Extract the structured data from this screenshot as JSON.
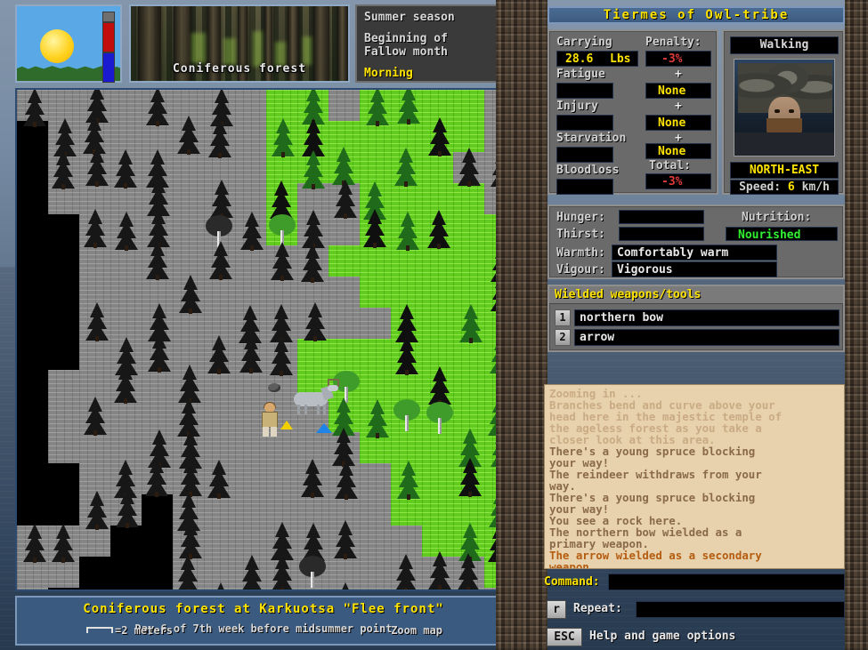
{
  "window": {
    "title": "Tiermes of Owl-tribe"
  },
  "sky_widget": {
    "name": "sky-and-temperature-gauge"
  },
  "biome": {
    "label": "Coniferous forest"
  },
  "season_box": {
    "line1": "Summer season",
    "line2a": "Beginning of",
    "line2b": "Fallow month",
    "line3": "Morning"
  },
  "stats": {
    "carrying_label": "Carrying",
    "carrying_value": "28.6",
    "carrying_unit": "Lbs",
    "penalty_label": "Penalty:",
    "penalty_value": "-3%",
    "fatigue_label": "Fatigue",
    "fatigue_value": "None",
    "injury_label": "Injury",
    "injury_value": "None",
    "starvation_label": "Starvation",
    "starvation_value": "None",
    "total_label": "Total:",
    "total_value": "-3%",
    "bloodloss_label": "Bloodloss",
    "plus": "+"
  },
  "portrait": {
    "mode": "Walking",
    "direction": "NORTH-EAST",
    "speed_label": "Speed:",
    "speed_value": "6",
    "speed_unit": "km/h",
    "compass_icon": "north-east-arrow-icon"
  },
  "condition": {
    "hunger_label": "Hunger:",
    "thirst_label": "Thirst:",
    "nutrition_label": "Nutrition:",
    "nutrition_value": "Nourished",
    "warmth_label": "Warmth:",
    "warmth_value": "Comfortably warm",
    "vigour_label": "Vigour:",
    "vigour_value": "Vigorous"
  },
  "wielded": {
    "header": "Wielded weapons/tools",
    "items": [
      {
        "key": "1",
        "name": "northern bow"
      },
      {
        "key": "2",
        "name": "arrow"
      }
    ]
  },
  "messages": [
    {
      "text": "Zooming in ...",
      "tone": "faded"
    },
    {
      "text": "Branches bend and curve above your",
      "tone": "faded"
    },
    {
      "text": "head here in the majestic temple of",
      "tone": "faded"
    },
    {
      "text": "the ageless forest as you take a",
      "tone": "faded"
    },
    {
      "text": "closer look at this area.",
      "tone": "faded"
    },
    {
      "text": "There's a young spruce blocking",
      "tone": "norm"
    },
    {
      "text": "your way!",
      "tone": "norm"
    },
    {
      "text": "The reindeer withdraws from your",
      "tone": "norm"
    },
    {
      "text": "way.",
      "tone": "norm"
    },
    {
      "text": "There's a young spruce blocking",
      "tone": "norm"
    },
    {
      "text": "your way!",
      "tone": "norm"
    },
    {
      "text": "You see a rock here.",
      "tone": "norm"
    },
    {
      "text": "The northern bow wielded as a",
      "tone": "norm"
    },
    {
      "text": "primary weapon.",
      "tone": "norm"
    },
    {
      "text": "The arrow wielded as a secondary",
      "tone": "hot"
    },
    {
      "text": "weapon.",
      "tone": "hot"
    }
  ],
  "command": {
    "label": "Command:",
    "value": "",
    "repeat_key": "r",
    "repeat_label": "Repeat:",
    "repeat_value": "",
    "esc_key": "ESC",
    "esc_label": "Help and game options"
  },
  "location": {
    "title": "Coniferous forest at Karkuotsa \"Flee front\"",
    "day": "Day 6 of 7th week before midsummer point",
    "scale": "=2 meters",
    "zoom": "Zoom map"
  },
  "colors": {
    "accent_yellow": "#ffe400",
    "penalty_red": "#e03a3a",
    "nutrition_green": "#32f032",
    "title_blue": "#3e5c80",
    "map_lit_green": "#6de01a",
    "map_dim_grey": "#8e8e8e"
  }
}
